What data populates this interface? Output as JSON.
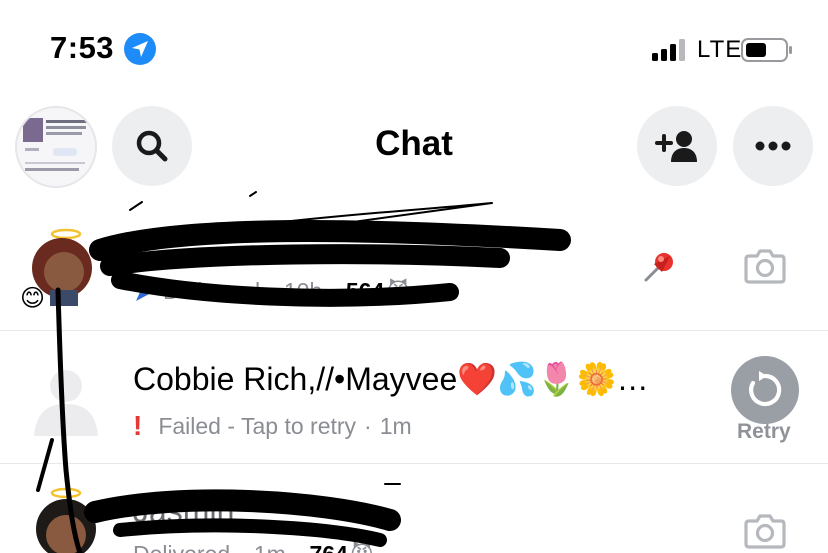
{
  "status_bar": {
    "time": "7:53",
    "network": "LTE",
    "icons": [
      "location-arrow-icon",
      "signal-icon",
      "battery-icon"
    ]
  },
  "header": {
    "title": "Chat",
    "buttons": [
      "search-icon",
      "add-friend-icon",
      "more-icon"
    ]
  },
  "chats": [
    {
      "name": "",
      "status": "Delivered",
      "time": "10h",
      "streak": "564",
      "streak_emoji": "😈",
      "friend_emoji": "😊",
      "pinned": true,
      "action": "camera-icon"
    },
    {
      "name": "Cobbie Rich,//•Mayvee❤️💦🌷🌼…",
      "status": "Failed - Tap to retry",
      "time": "1m",
      "action": "retry-icon",
      "action_label": "Retry"
    },
    {
      "name": "Jasmin",
      "status": "Delivered",
      "time": "1m",
      "streak": "764",
      "streak_emoji": "😈",
      "action": "camera-icon"
    }
  ],
  "colors": {
    "location_blue": "#1d8cf8",
    "button_gray": "#eceef0",
    "retry_gray": "#9a9ea5",
    "status_gray": "#8a8d93",
    "failed_red": "#e53935"
  }
}
